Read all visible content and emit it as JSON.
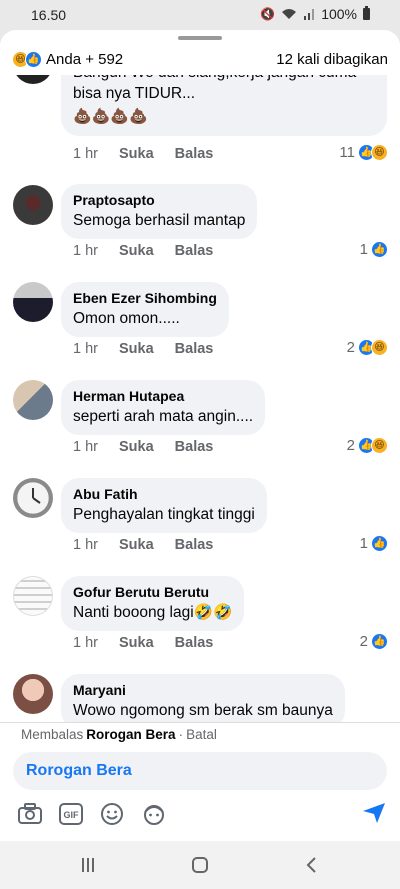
{
  "status_bar": {
    "time": "16.50",
    "battery": "100%"
  },
  "reactions_header": {
    "summary": "Anda + 592",
    "shares": "12 kali dibagikan",
    "icons": [
      "haha-icon",
      "like-icon"
    ]
  },
  "comments": [
    {
      "name": "",
      "text_lines": [
        "Bangun Wo dan siang,kerja jangan cuma",
        "bisa nya TIDUR..."
      ],
      "emoji_line": "💩💩💩💩",
      "time": "1 hr",
      "like_label": "Suka",
      "reply_label": "Balas",
      "reaction_count": "11",
      "reactions": [
        "like",
        "haha"
      ]
    },
    {
      "name": "Praptosapto",
      "text": "Semoga berhasil mantap",
      "time": "1 hr",
      "like_label": "Suka",
      "reply_label": "Balas",
      "reaction_count": "1",
      "reactions": [
        "like"
      ]
    },
    {
      "name": "Eben Ezer Sihombing",
      "text": "Omon omon.....",
      "time": "1 hr",
      "like_label": "Suka",
      "reply_label": "Balas",
      "reaction_count": "2",
      "reactions": [
        "like",
        "haha"
      ]
    },
    {
      "name": "Herman Hutapea",
      "text": "seperti arah mata angin....",
      "time": "1 hr",
      "like_label": "Suka",
      "reply_label": "Balas",
      "reaction_count": "2",
      "reactions": [
        "like",
        "haha"
      ]
    },
    {
      "name": "Abu Fatih",
      "text": "Penghayalan tingkat tinggi",
      "time": "1 hr",
      "like_label": "Suka",
      "reply_label": "Balas",
      "reaction_count": "1",
      "reactions": [
        "like"
      ]
    },
    {
      "name": "Gofur Berutu Berutu",
      "text": "Nanti booong lagi🤣🤣",
      "time": "1 hr",
      "like_label": "Suka",
      "reply_label": "Balas",
      "reaction_count": "2",
      "reactions": [
        "like"
      ]
    },
    {
      "name": "Maryani",
      "text": "Wowo ngomong sm berak sm baunya",
      "time": "",
      "like_label": "",
      "reply_label": "",
      "reaction_count": "",
      "reactions": []
    }
  ],
  "reply_banner": {
    "prefix": "Membalas",
    "target": "Rorogan Bera",
    "separator": "·",
    "cancel": "Batal"
  },
  "composer": {
    "value": "Rorogan Bera"
  },
  "colors": {
    "accent": "#1877f2",
    "bubble": "#f0f2f5",
    "meta": "#65676b"
  }
}
